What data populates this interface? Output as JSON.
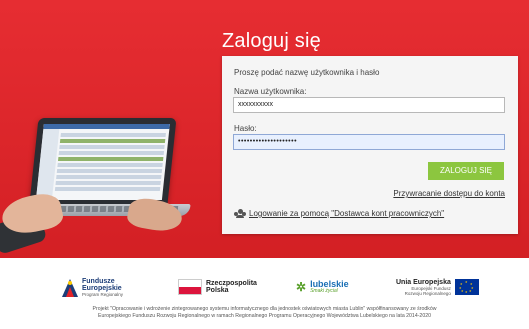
{
  "login": {
    "title": "Zaloguj się",
    "prompt": "Proszę podać nazwę użytkownika i hasło",
    "username_label": "Nazwa użytkownika:",
    "username_value": "xxxxxxxxxx",
    "password_label": "Hasło:",
    "password_value": "••••••••••••••••••••",
    "submit_label": "ZALOGUJ SIĘ",
    "reset_link": "Przywracanie dostępu do konta",
    "provider_link": " Logowanie za pomocą \"Dostawca kont pracowniczych\""
  },
  "logos": {
    "fe_title": "Fundusze",
    "fe_title2": "Europejskie",
    "fe_sub": "Program Regionalny",
    "rp_title": "Rzeczpospolita",
    "rp_title2": "Polska",
    "lub_name": "lubelskie",
    "lub_tag": "Smaki życia!",
    "ue_title": "Unia Europejska",
    "ue_sub": "Europejski Fundusz",
    "ue_sub2": "Rozwoju Regionalnego"
  },
  "footer": {
    "line1": "Projekt \"Opracowanie i wdrożenie zintegrowanego systemu informatycznego dla jednostek oświatowych miasta Lublin\" współfinansowany ze środków",
    "line2": "Europejskiego Funduszu Rozwoju Regionalnego w ramach Regionalnego Programu Operacyjnego Województwa Lubelskiego na lata 2014-2020"
  },
  "colors": {
    "hero_red": "#e52227",
    "button_green": "#8cc63f",
    "panel_bg": "#f5f5f5"
  }
}
